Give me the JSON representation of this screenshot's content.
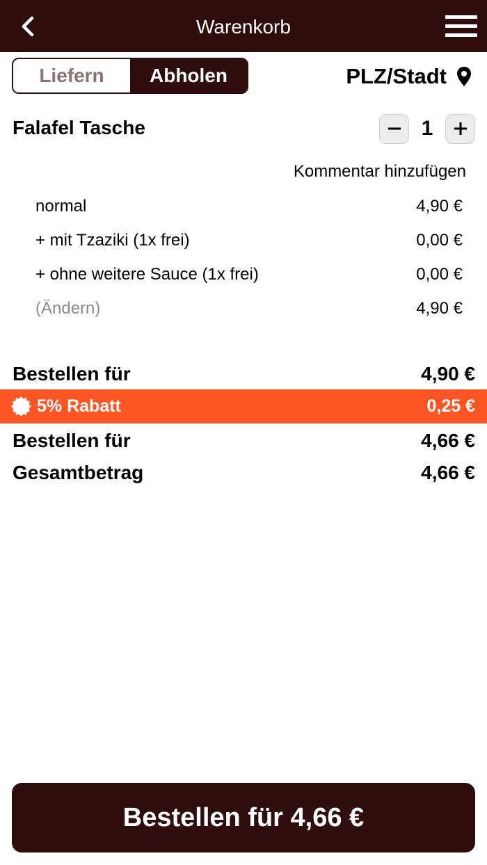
{
  "header": {
    "title": "Warenkorb",
    "back_icon": "chevron-left-icon",
    "menu_icon": "hamburger-menu-icon",
    "bg_color": "#2e0d0c"
  },
  "mode_toggle": {
    "deliver_label": "Liefern",
    "pickup_label": "Abholen",
    "selected": "Abholen"
  },
  "location": {
    "label": "PLZ/Stadt",
    "icon": "map-pin-icon"
  },
  "cart_item": {
    "name": "Falafel Tasche",
    "quantity": "1",
    "minus_icon": "minus-icon",
    "plus_icon": "plus-icon",
    "comment_link": "Kommentar hinzufügen",
    "options": [
      {
        "label": "normal",
        "price": "4,90 €"
      },
      {
        "label": "+ mit Tzaziki (1x frei)",
        "price": "0,00 €"
      },
      {
        "label": "+ ohne weitere Sauce (1x frei)",
        "price": "0,00 €"
      }
    ],
    "change_link": "(Ändern)",
    "item_total": "4,90 €"
  },
  "summary": {
    "subtotal_label": "Bestellen für",
    "subtotal_value": "4,90 €",
    "discount_icon": "badge-star-icon",
    "discount_label": "5% Rabatt",
    "discount_value": "0,25 €",
    "discount_color": "#fd5624",
    "after_discount_label": "Bestellen für",
    "after_discount_value": "4,66 €",
    "total_label": "Gesamtbetrag",
    "total_value": "4,66 €"
  },
  "order_button": {
    "label": "Bestellen für 4,66 €"
  }
}
